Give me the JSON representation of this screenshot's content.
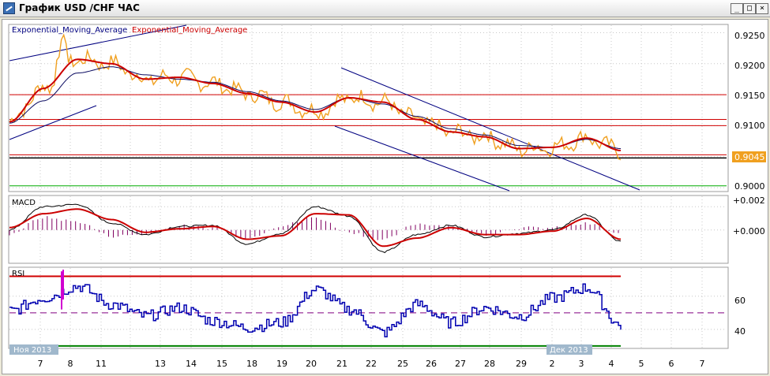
{
  "window": {
    "title": "График USD /CHF  ЧАС",
    "minimize_glyph": "_",
    "restore_glyph": "□",
    "close_glyph": "×",
    "icon": "chart-app-icon"
  },
  "price_panel": {
    "legend_1": "Exponential_Moving_Average",
    "legend_2": "Exponential_Moving_Average",
    "current_price_label": "0.9045",
    "y_ticks": [
      "0.9250",
      "0.9200",
      "0.9150",
      "0.9100",
      "0.9000"
    ]
  },
  "macd_panel": {
    "title": "MACD",
    "y_ticks": [
      "+0.002",
      "+0.000"
    ]
  },
  "rsi_panel": {
    "title": "RSI",
    "y_ticks": [
      "60",
      "40"
    ]
  },
  "x_axis": {
    "month_labels": [
      "Ноя 2013",
      "Дек 2013"
    ],
    "day_labels": [
      "7",
      "8",
      "11",
      "13",
      "14",
      "15",
      "18",
      "19",
      "20",
      "21",
      "22",
      "25",
      "26",
      "27",
      "28",
      "29",
      "2",
      "3",
      "4",
      "5",
      "6",
      "7"
    ]
  },
  "colors": {
    "price": "#f0a020",
    "ema_fast": "#0a0a60",
    "ema_slow": "#cc0000",
    "channel": "#000080",
    "hline_red": "#d00000",
    "hline_black": "#000000",
    "hline_green": "#00aa00",
    "macd_hist": "#800060",
    "rsi_line": "#0000b0",
    "rsi_spike": "#d000d0",
    "rsi_mid": "#800080",
    "rsi_upper": "#d00000",
    "rsi_lower": "#008000"
  },
  "chart_data": [
    {
      "type": "line",
      "title": "",
      "series": [
        {
          "name": "Exponential_Moving_Average",
          "values": [
            0.9106,
            0.916,
            0.9207,
            0.92,
            0.9175,
            0.9178,
            0.9168,
            0.9152,
            0.9138,
            0.9122,
            0.9145,
            0.9138,
            0.911,
            0.909,
            0.9082,
            0.9063,
            0.9065,
            0.908,
            0.906
          ]
        },
        {
          "name": "Exponential_Moving_Average",
          "values": [
            0.9104,
            0.914,
            0.9185,
            0.9195,
            0.9182,
            0.9175,
            0.917,
            0.9155,
            0.914,
            0.9126,
            0.9145,
            0.9135,
            0.9115,
            0.9095,
            0.9085,
            0.9068,
            0.9065,
            0.9078,
            0.9063
          ]
        }
      ],
      "x": [
        "7",
        "8",
        "11",
        "13",
        "14",
        "15",
        "18",
        "19",
        "20",
        "21",
        "22",
        "25",
        "26",
        "27",
        "28",
        "29",
        "2",
        "3",
        "4"
      ],
      "current_value": 0.9045,
      "horizontal_lines": [
        0.915,
        0.911,
        0.91,
        0.9053,
        0.9048,
        0.9003
      ],
      "ylim": [
        0.8995,
        0.9262
      ]
    },
    {
      "type": "line",
      "title": "MACD",
      "x": [
        "7",
        "8",
        "11",
        "13",
        "14",
        "15",
        "18",
        "19",
        "20",
        "21",
        "22",
        "25",
        "26",
        "27",
        "28",
        "29",
        "2",
        "3",
        "4"
      ],
      "series": [
        {
          "name": "",
          "values": [
            0.0,
            0.002,
            0.0022,
            0.0006,
            -0.0004,
            0.0003,
            0.0004,
            -0.0012,
            -0.0003,
            0.002,
            0.0012,
            -0.0019,
            -0.0004,
            0.0004,
            -0.0006,
            -0.0003,
            0.0,
            0.0013,
            -0.001
          ]
        },
        {
          "name": "",
          "values": [
            0.0002,
            0.0014,
            0.0018,
            0.0009,
            -0.0002,
            0.0001,
            0.0003,
            -0.0008,
            -0.0005,
            0.0014,
            0.0013,
            -0.0014,
            -0.0007,
            0.0002,
            -0.0004,
            -0.0004,
            -0.0001,
            0.001,
            -0.0008
          ]
        }
      ],
      "ylim": [
        -0.0028,
        0.0029
      ]
    },
    {
      "type": "line",
      "title": "RSI",
      "x": [
        "7",
        "8",
        "11",
        "13",
        "14",
        "15",
        "18",
        "19",
        "20",
        "21",
        "22",
        "25",
        "26",
        "27",
        "28",
        "29",
        "2",
        "3",
        "4"
      ],
      "series": [
        {
          "name": "",
          "values": [
            51,
            59,
            66,
            55,
            48,
            53,
            45,
            41,
            44,
            64,
            52,
            38,
            55,
            44,
            53,
            48,
            59,
            65,
            42
          ]
        }
      ],
      "reference_lines": [
        72,
        50,
        30
      ],
      "ylim": [
        29,
        77
      ]
    }
  ]
}
